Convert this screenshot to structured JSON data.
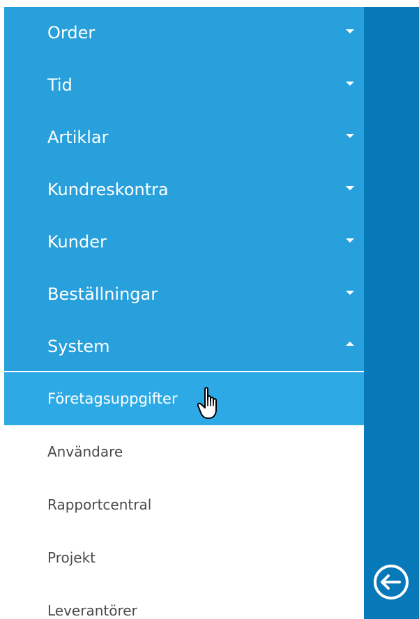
{
  "menu": {
    "items": [
      {
        "label": "Order",
        "expanded": false
      },
      {
        "label": "Tid",
        "expanded": false
      },
      {
        "label": "Artiklar",
        "expanded": false
      },
      {
        "label": "Kundreskontra",
        "expanded": false
      },
      {
        "label": "Kunder",
        "expanded": false
      },
      {
        "label": "Beställningar",
        "expanded": false
      },
      {
        "label": "System",
        "expanded": true
      }
    ],
    "submenu": [
      {
        "label": "Företagsuppgifter",
        "active": true
      },
      {
        "label": "Användare",
        "active": false
      },
      {
        "label": "Rapportcentral",
        "active": false
      },
      {
        "label": "Projekt",
        "active": false
      },
      {
        "label": "Leverantörer",
        "active": false
      }
    ]
  },
  "icons": {
    "collapse": "arrow-left-circle-icon",
    "cursor": "hand-pointer-icon",
    "caret_down": "chevron-down-icon",
    "caret_up": "chevron-up-icon"
  },
  "colors": {
    "menu_background": "#28a0db",
    "active_item": "#2daae5",
    "rail": "#0778b8",
    "submenu_text": "#4a4a4a",
    "white": "#ffffff"
  }
}
